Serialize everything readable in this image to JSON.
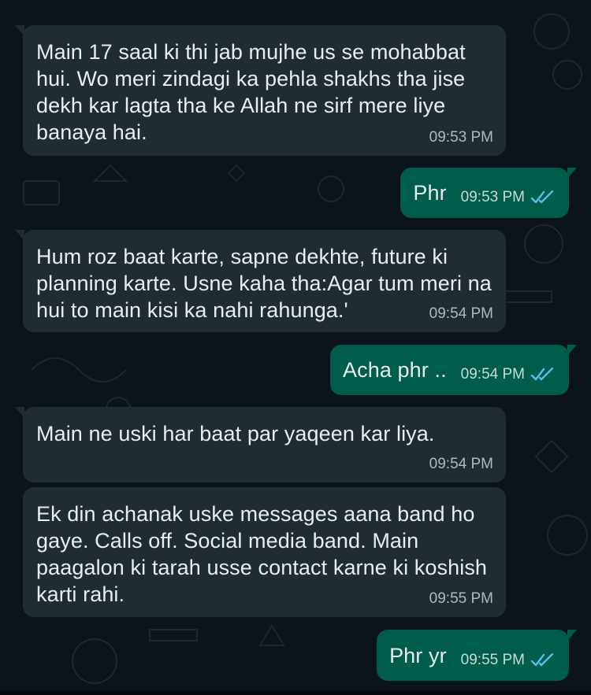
{
  "messages": [
    {
      "direction": "incoming",
      "text": "Main 17 saal ki thi jab mujhe us se mohabbat hui. Wo meri zindagi ka pehla shakhs tha jise dekh kar lagta tha ke Allah ne sirf mere liye banaya hai.",
      "time": "09:53 PM"
    },
    {
      "direction": "outgoing",
      "text": "Phr",
      "time": "09:53 PM",
      "status": "read"
    },
    {
      "direction": "incoming",
      "text": "Hum roz baat karte, sapne dekhte, future ki planning karte. Usne kaha tha:Agar tum meri na hui to main kisi ka nahi rahunga.'",
      "time": "09:54 PM"
    },
    {
      "direction": "outgoing",
      "text": "Acha phr ..",
      "time": "09:54 PM",
      "status": "read"
    },
    {
      "direction": "incoming",
      "text": "Main ne uski har baat par yaqeen kar liya.",
      "time": "09:54 PM"
    },
    {
      "direction": "incoming",
      "text": "Ek din achanak uske messages aana band ho gaye. Calls off. Social media band. Main paagalon ki tarah usse contact karne ki koshish karti rahi.",
      "time": "09:55 PM"
    },
    {
      "direction": "outgoing",
      "text": "Phr yr",
      "time": "09:55 PM",
      "status": "read"
    }
  ],
  "colors": {
    "background": "#0b141a",
    "incoming_bubble": "#202c33",
    "outgoing_bubble": "#005c4b",
    "text": "#e9edef",
    "timestamp": "#aebac1",
    "read_tick": "#53bdeb"
  },
  "icons": {
    "read_receipt": "double-check-icon"
  }
}
